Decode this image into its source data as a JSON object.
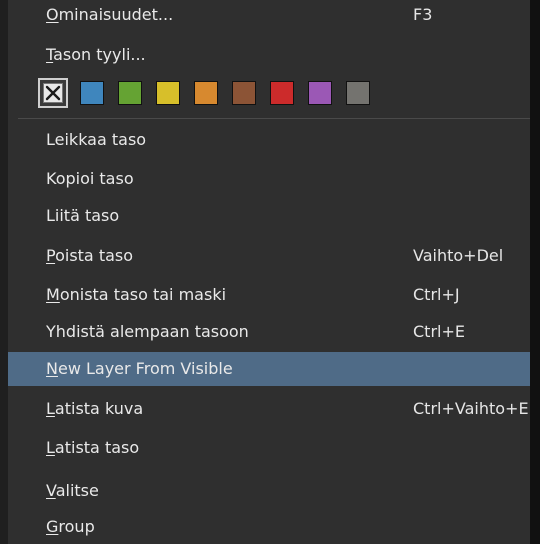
{
  "menu": {
    "top_items": [
      {
        "label": "Ominaisuudet...",
        "mn": "O",
        "rest": "minaisuudet...",
        "shortcut": "F3"
      },
      {
        "label": "Tason tyyli...",
        "mn": "T",
        "rest": "ason tyyli..."
      }
    ],
    "color_swatches": [
      {
        "name": "none",
        "color": "#d9d9d9"
      },
      {
        "name": "blue",
        "color": "#3f86bd"
      },
      {
        "name": "green",
        "color": "#65a333"
      },
      {
        "name": "yellow",
        "color": "#d7bf2a"
      },
      {
        "name": "orange",
        "color": "#d7892f"
      },
      {
        "name": "brown",
        "color": "#8c5436"
      },
      {
        "name": "red",
        "color": "#cc2b2b"
      },
      {
        "name": "violet",
        "color": "#9b58b5"
      },
      {
        "name": "gray",
        "color": "#74736f"
      }
    ],
    "items": [
      {
        "label": "Leikkaa taso"
      },
      {
        "label": "Kopioi taso"
      },
      {
        "label": "Liitä taso"
      },
      {
        "label": "Poista taso",
        "mn": "P",
        "rest": "oista taso",
        "shortcut": "Vaihto+Del"
      },
      {
        "label": "Monista taso tai maski",
        "mn": "M",
        "rest": "onista taso tai maski",
        "shortcut": "Ctrl+J"
      },
      {
        "label": "Yhdistä alempaan tasoon",
        "shortcut": "Ctrl+E"
      },
      {
        "label": "New Layer From Visible",
        "mn": "N",
        "rest": "ew Layer From Visible",
        "highlighted": true
      },
      {
        "label": "Latista kuva",
        "mn": "L",
        "rest": "atista kuva",
        "shortcut": "Ctrl+Vaihto+E"
      },
      {
        "label": "Latista taso",
        "mn": "L",
        "rest": "atista taso"
      },
      {
        "label": "Valitse",
        "mn": "V",
        "rest": "alitse"
      },
      {
        "label": "Group",
        "mn": "G",
        "rest": "roup"
      }
    ]
  },
  "colors": {
    "menu_bg": "#2f2f2f",
    "highlight": "#4f6b87",
    "text": "#e9e9e9"
  }
}
